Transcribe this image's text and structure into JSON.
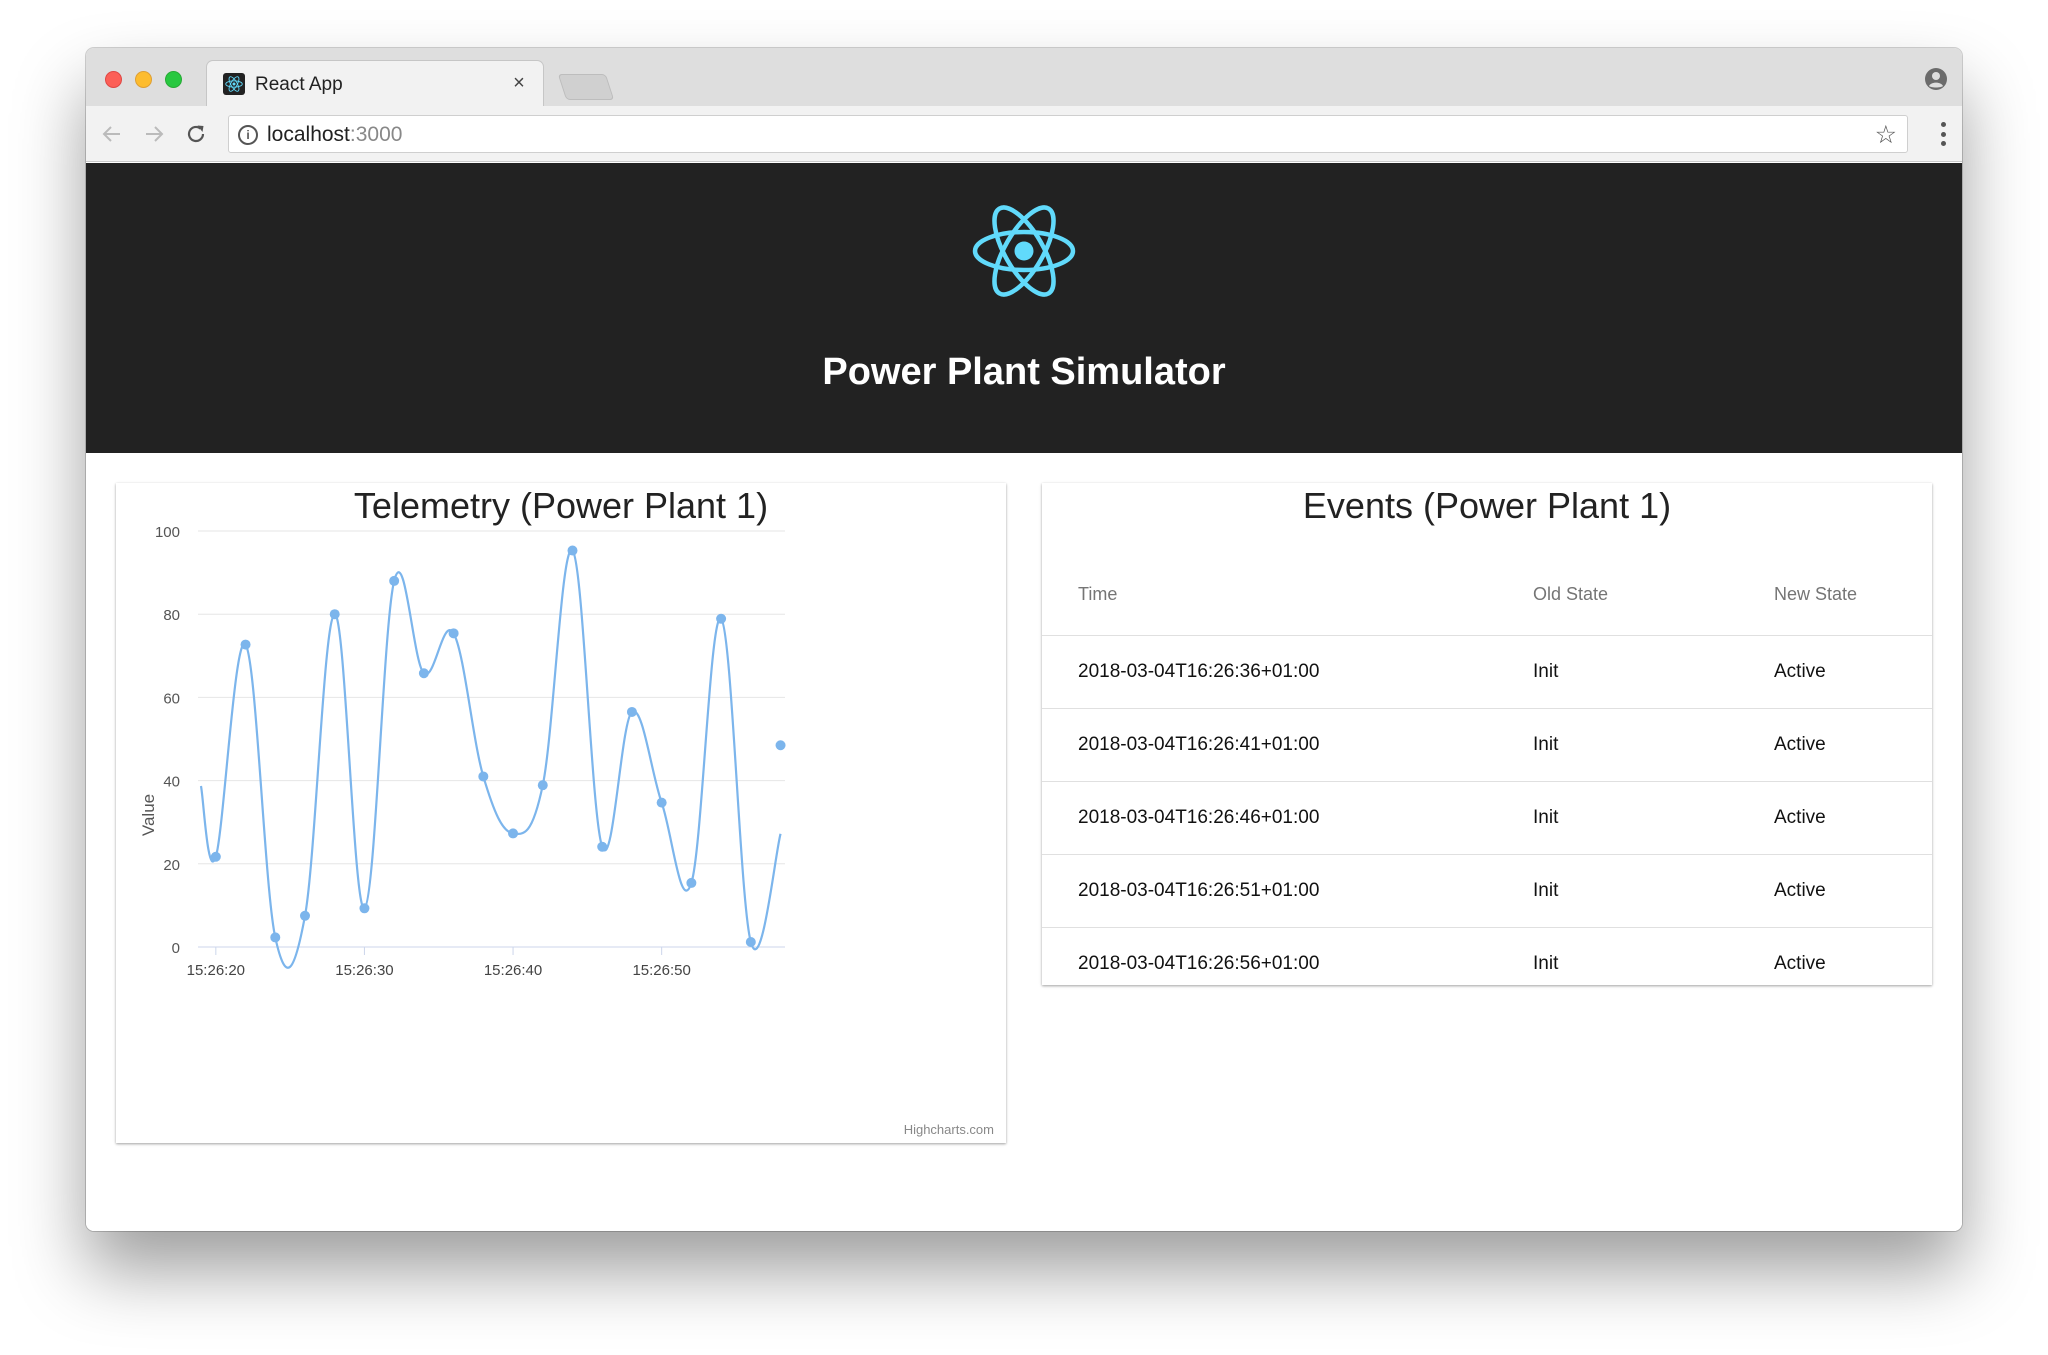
{
  "browser": {
    "tab_title": "React App",
    "tab_close": "×",
    "url_host": "localhost",
    "url_port": ":3000",
    "icons": {
      "back": "back-arrow-icon",
      "forward": "forward-arrow-icon",
      "reload": "reload-icon",
      "info": "info-icon",
      "bookmark": "star-icon",
      "menu": "kebab-menu-icon",
      "profile": "profile-icon"
    }
  },
  "app": {
    "title": "Power Plant Simulator",
    "logo": "react-logo-icon",
    "accent": "#61dafb",
    "header_bg": "#222222"
  },
  "telemetry": {
    "title": "Telemetry (Power Plant 1)",
    "credits": "Highcharts.com"
  },
  "chart_data": {
    "type": "line",
    "title": "Telemetry (Power Plant 1)",
    "xlabel": "",
    "ylabel": "Value",
    "ylim": [
      0,
      100
    ],
    "yticks": [
      0,
      20,
      40,
      60,
      80,
      100
    ],
    "xlim": [
      "15:26:18.8",
      "15:26:58.3"
    ],
    "xticks": [
      "15:26:20",
      "15:26:30",
      "15:26:40",
      "15:26:50"
    ],
    "grid": true,
    "legend": "none",
    "color": "#7cb5ec",
    "series": [
      {
        "x": [
          "15:26:19",
          "15:26:20",
          "15:26:22",
          "15:26:24",
          "15:26:26",
          "15:26:28",
          "15:26:30",
          "15:26:32",
          "15:26:34",
          "15:26:36",
          "15:26:38",
          "15:26:40",
          "15:26:42",
          "15:26:44",
          "15:26:46",
          "15:26:48",
          "15:26:50",
          "15:26:52",
          "15:26:54",
          "15:26:56",
          "15:26:58"
        ],
        "values": [
          38.7,
          21.7,
          72.7,
          2.3,
          7.5,
          80.0,
          9.3,
          88.0,
          65.8,
          75.4,
          41.0,
          27.3,
          38.9,
          95.3,
          24.1,
          56.5,
          34.7,
          15.4,
          78.9,
          1.2,
          27.2
        ]
      },
      {
        "x": [
          "15:26:58"
        ],
        "values": [
          48.5
        ],
        "markers_only": true
      }
    ]
  },
  "events": {
    "title": "Events (Power Plant 1)",
    "columns": [
      "Time",
      "Old State",
      "New State"
    ],
    "rows": [
      [
        "2018-03-04T16:26:36+01:00",
        "Init",
        "Active"
      ],
      [
        "2018-03-04T16:26:41+01:00",
        "Init",
        "Active"
      ],
      [
        "2018-03-04T16:26:46+01:00",
        "Init",
        "Active"
      ],
      [
        "2018-03-04T16:26:51+01:00",
        "Init",
        "Active"
      ],
      [
        "2018-03-04T16:26:56+01:00",
        "Init",
        "Active"
      ]
    ]
  }
}
